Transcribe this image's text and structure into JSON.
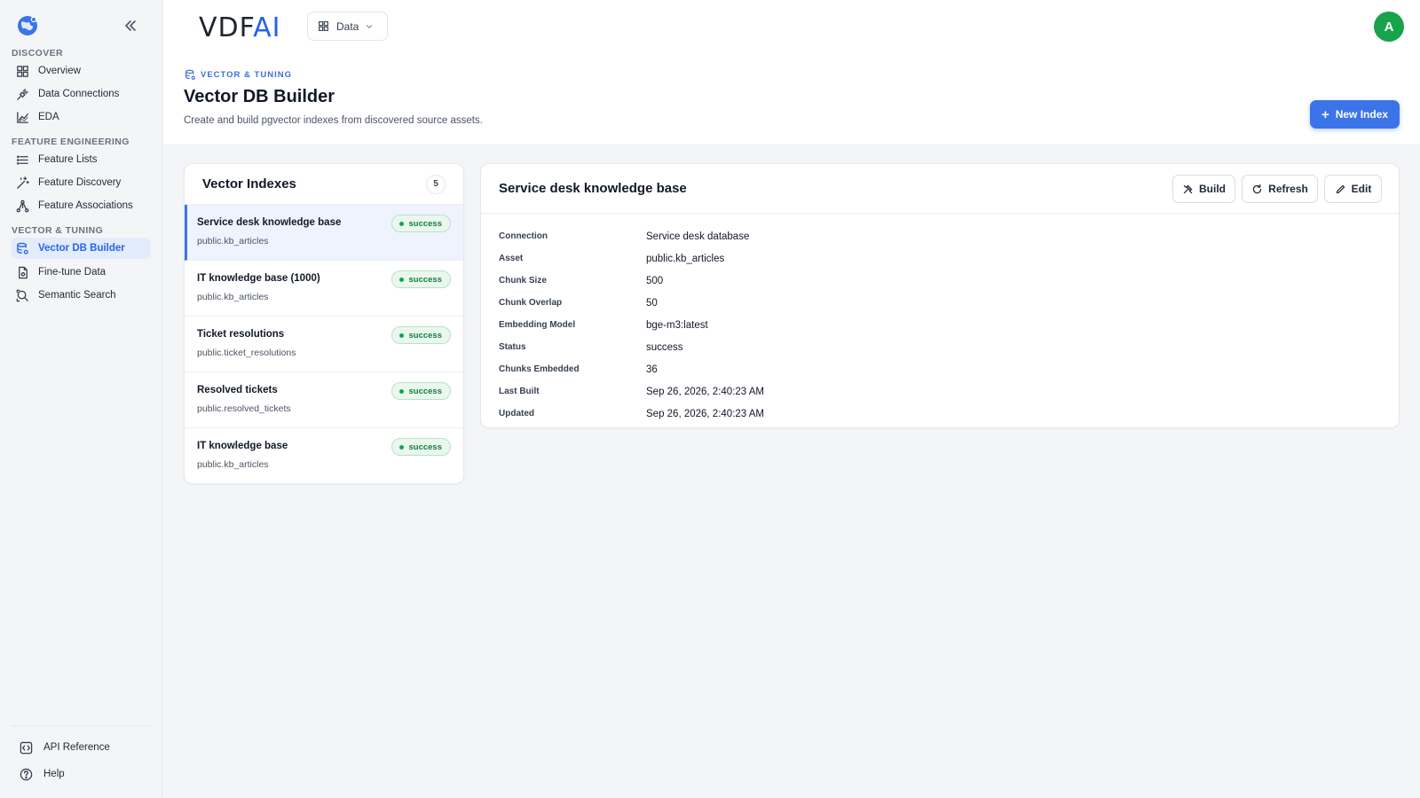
{
  "app": {
    "brand_main": "VDF",
    "brand_accent": "AI",
    "accent_color": "#3b74e8",
    "success_color": "#16a34a"
  },
  "workspace": {
    "label": "Data"
  },
  "user": {
    "initial": "A"
  },
  "sidebar": {
    "sections": [
      {
        "title": "DISCOVER",
        "items": [
          {
            "label": "Overview",
            "icon": "grid-icon"
          },
          {
            "label": "Data Connections",
            "icon": "plug-icon"
          },
          {
            "label": "EDA",
            "icon": "chart-icon"
          }
        ]
      },
      {
        "title": "FEATURE ENGINEERING",
        "items": [
          {
            "label": "Feature Lists",
            "icon": "list-icon"
          },
          {
            "label": "Feature Discovery",
            "icon": "wand-icon"
          },
          {
            "label": "Feature Associations",
            "icon": "network-icon"
          }
        ]
      },
      {
        "title": "VECTOR & TUNING",
        "items": [
          {
            "label": "Vector DB Builder",
            "icon": "database-gear-icon",
            "active": true
          },
          {
            "label": "Fine-tune Data",
            "icon": "file-icon"
          },
          {
            "label": "Semantic Search",
            "icon": "search-icon"
          }
        ]
      }
    ],
    "footer": [
      {
        "label": "API Reference",
        "icon": "code-icon"
      },
      {
        "label": "Help",
        "icon": "help-icon"
      }
    ]
  },
  "header": {
    "eyebrow": "VECTOR & TUNING",
    "title": "Vector DB Builder",
    "description": "Create and build pgvector indexes from discovered source assets.",
    "new_button": "New Index"
  },
  "indexes": {
    "title": "Vector Indexes",
    "count": "5",
    "items": [
      {
        "name": "Service desk knowledge base",
        "asset": "public.kb_articles",
        "status": "success",
        "active": true
      },
      {
        "name": "IT knowledge base (1000)",
        "asset": "public.kb_articles",
        "status": "success"
      },
      {
        "name": "Ticket resolutions",
        "asset": "public.ticket_resolutions",
        "status": "success"
      },
      {
        "name": "Resolved tickets",
        "asset": "public.resolved_tickets",
        "status": "success"
      },
      {
        "name": "IT knowledge base",
        "asset": "public.kb_articles",
        "status": "success"
      }
    ]
  },
  "detail": {
    "title": "Service desk knowledge base",
    "actions": {
      "build": "Build",
      "refresh": "Refresh",
      "edit": "Edit"
    },
    "properties": [
      {
        "key": "Connection",
        "value": "Service desk database"
      },
      {
        "key": "Asset",
        "value": "public.kb_articles"
      },
      {
        "key": "Chunk Size",
        "value": "500"
      },
      {
        "key": "Chunk Overlap",
        "value": "50"
      },
      {
        "key": "Embedding Model",
        "value": "bge-m3:latest"
      },
      {
        "key": "Status",
        "value": "success"
      },
      {
        "key": "Chunks Embedded",
        "value": "36"
      },
      {
        "key": "Last Built",
        "value": "Sep 26, 2026, 2:40:23 AM"
      },
      {
        "key": "Updated",
        "value": "Sep 26, 2026, 2:40:23 AM"
      }
    ]
  }
}
